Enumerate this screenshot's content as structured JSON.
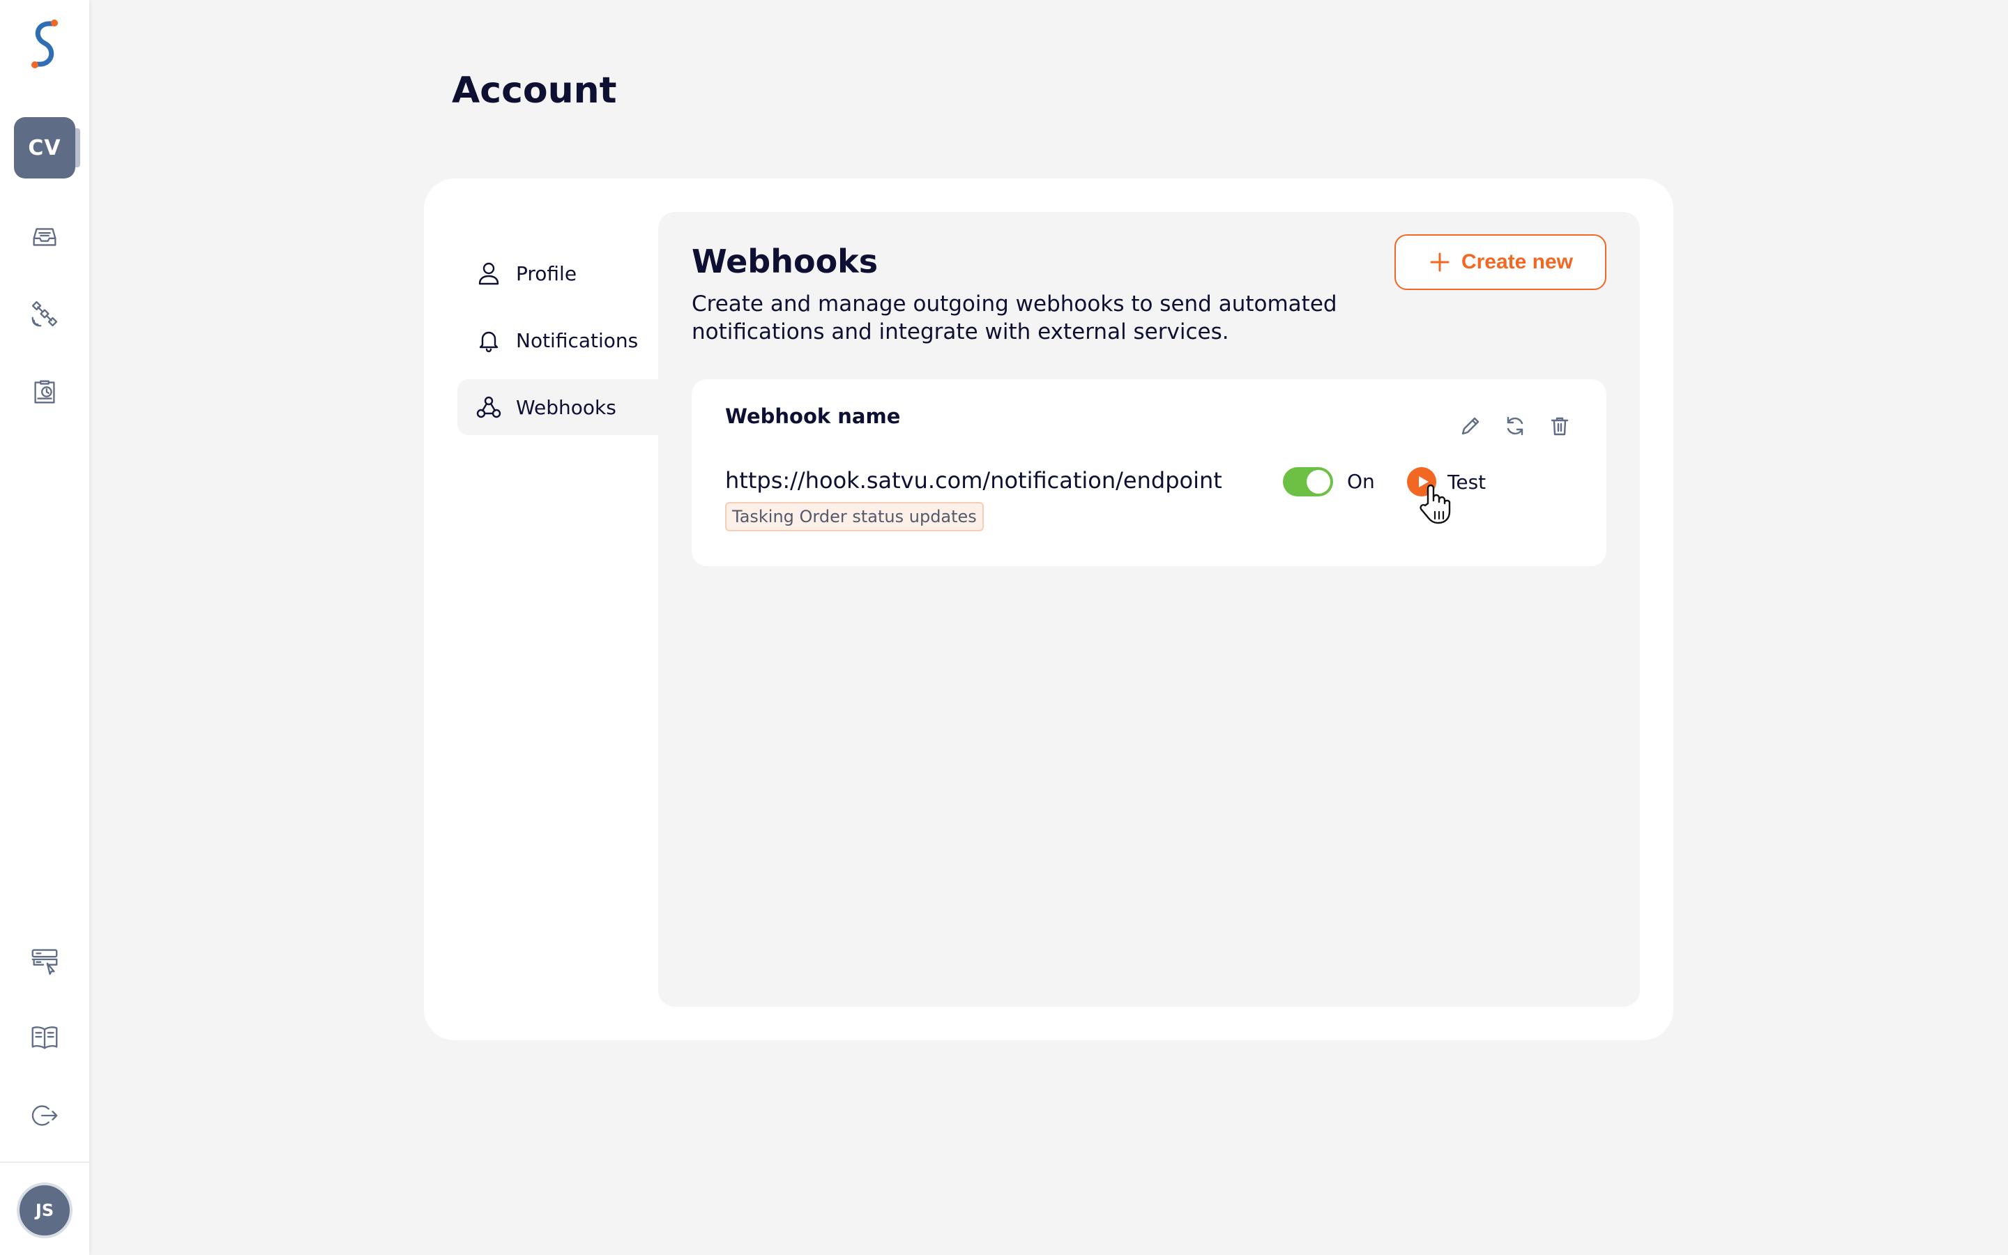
{
  "app": {
    "org_initials": "CV",
    "user_initials": "JS",
    "brand_colors": {
      "accent": "#f26722",
      "navy": "#0e1033",
      "slate": "#5f6c85",
      "toggle_on": "#6cc043"
    }
  },
  "rail": {
    "icons": [
      "inbox-icon",
      "satellite-icon",
      "clipboard-clock-icon",
      "server-cursor-icon",
      "book-icon",
      "logout-icon"
    ]
  },
  "page": {
    "title": "Account"
  },
  "side_nav": {
    "items": [
      {
        "label": "Profile",
        "icon": "user-icon",
        "active": false
      },
      {
        "label": "Notifications",
        "icon": "bell-icon",
        "active": false
      },
      {
        "label": "Webhooks",
        "icon": "webhook-icon",
        "active": true
      }
    ]
  },
  "webhooks": {
    "title": "Webhooks",
    "description": "Create and manage outgoing webhooks to send automated notifications and integrate with external services.",
    "create_label": "Create new",
    "items": [
      {
        "name": "Webhook name",
        "url": "https://hook.satvu.com/notification/endpoint",
        "tag": "Tasking Order status updates",
        "enabled": true,
        "toggle_label": "On",
        "test_label": "Test"
      }
    ]
  }
}
